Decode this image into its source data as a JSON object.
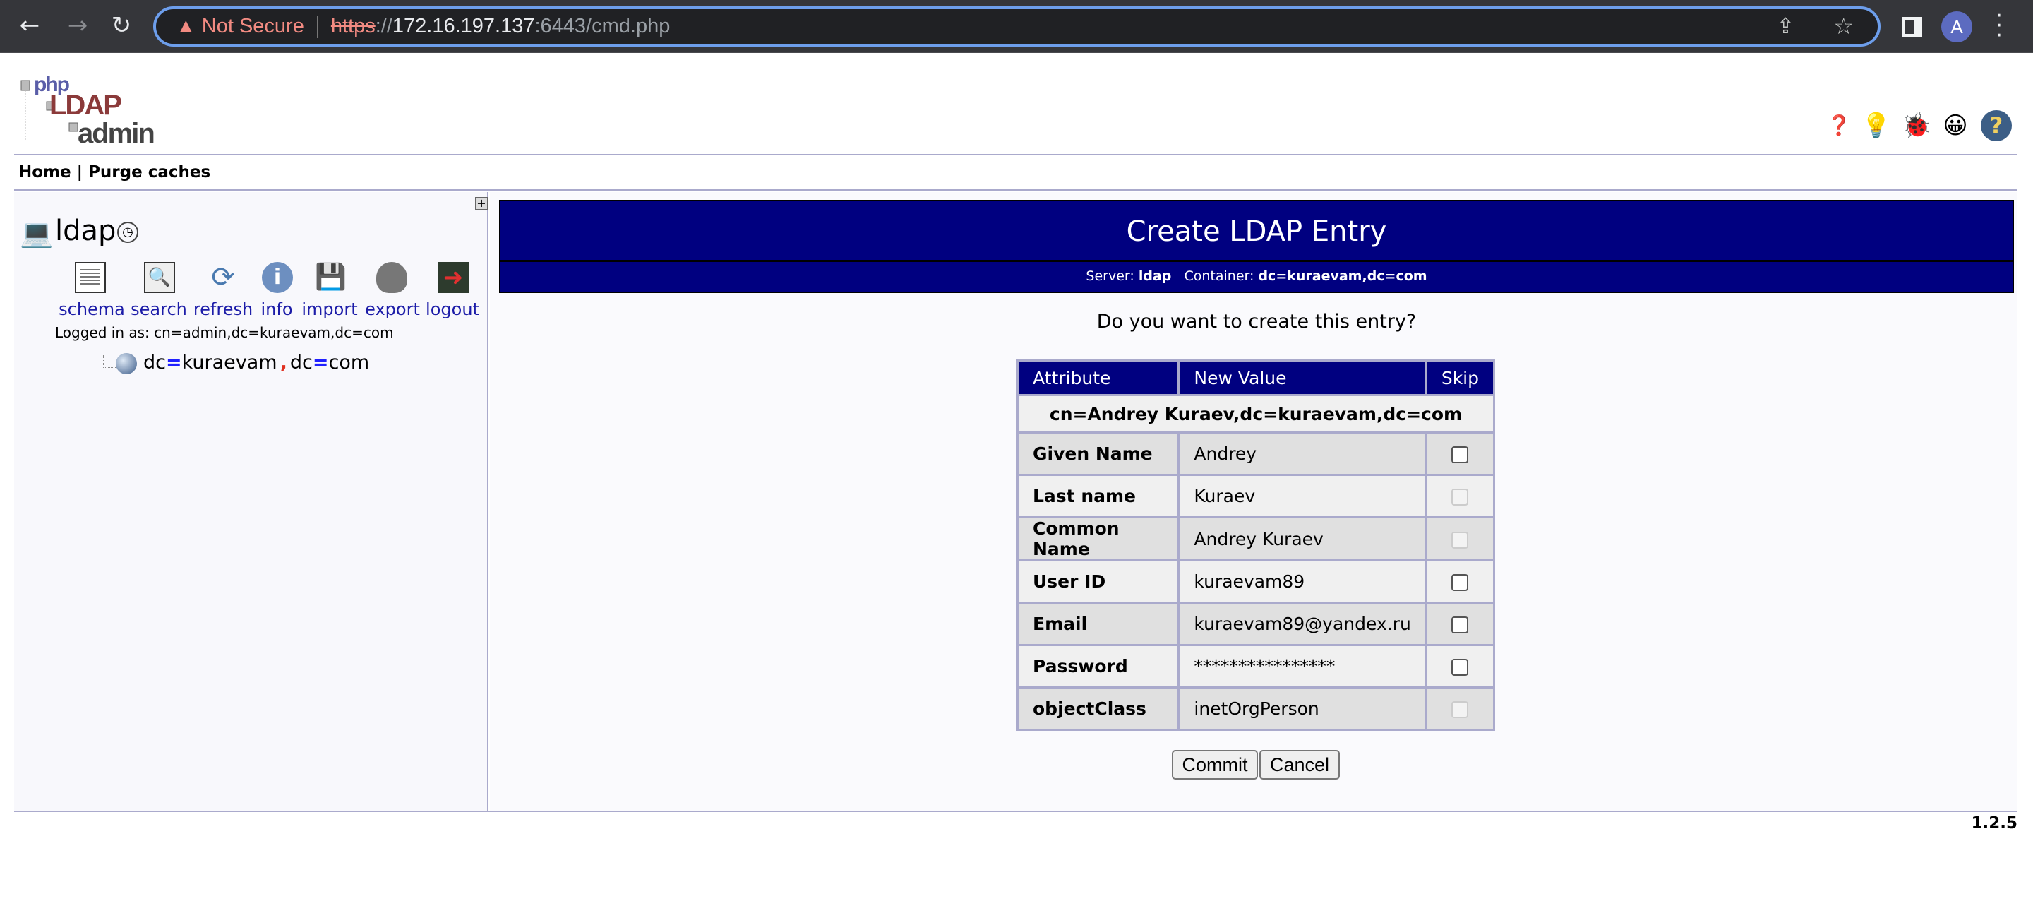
{
  "browser": {
    "security_label": "Not Secure",
    "url_scheme": "https",
    "url_sep": "://",
    "url_host": "172.16.197.137",
    "url_rest": ":6443/cmd.php",
    "profile_initial": "A"
  },
  "logo": {
    "text_php": "php",
    "text_ldap": "LDAP",
    "text_admin": "admin"
  },
  "menu": {
    "home": "Home",
    "separator": "|",
    "purge": "Purge caches"
  },
  "server": {
    "name": "ldap",
    "links": [
      "schema",
      "search",
      "refresh",
      "info",
      "import",
      "export",
      "logout"
    ],
    "logged_in": "Logged in as: cn=admin,dc=kuraevam,dc=com",
    "tree_root": {
      "k1": "dc",
      "eq": "=",
      "v1": "kuraevam",
      "comma": ",",
      "k2": "dc",
      "v2": "com"
    }
  },
  "banner": {
    "title": "Create LDAP Entry",
    "server_label": "Server:",
    "server_value": "ldap",
    "container_label": "Container:",
    "container_value": "dc=kuraevam,dc=com"
  },
  "question": "Do you want to create this entry?",
  "table": {
    "headers": [
      "Attribute",
      "New Value",
      "Skip"
    ],
    "dn": "cn=Andrey Kuraev,dc=kuraevam,dc=com",
    "rows": [
      {
        "attr": "Given Name",
        "value": "Andrey",
        "skip_enabled": true
      },
      {
        "attr": "Last name",
        "value": "Kuraev",
        "skip_enabled": false
      },
      {
        "attr": "Common Name",
        "value": "Andrey Kuraev",
        "skip_enabled": false
      },
      {
        "attr": "User ID",
        "value": "kuraevam89",
        "skip_enabled": true
      },
      {
        "attr": "Email",
        "value": "kuraevam89@yandex.ru",
        "skip_enabled": true
      },
      {
        "attr": "Password",
        "value": "****************",
        "skip_enabled": true
      },
      {
        "attr": "objectClass",
        "value": "inetOrgPerson",
        "skip_enabled": false
      }
    ]
  },
  "buttons": {
    "commit": "Commit",
    "cancel": "Cancel"
  },
  "version": "1.2.5",
  "colors": {
    "banner": "#000080",
    "link": "#1c1ca8",
    "border": "#aaaacc"
  }
}
